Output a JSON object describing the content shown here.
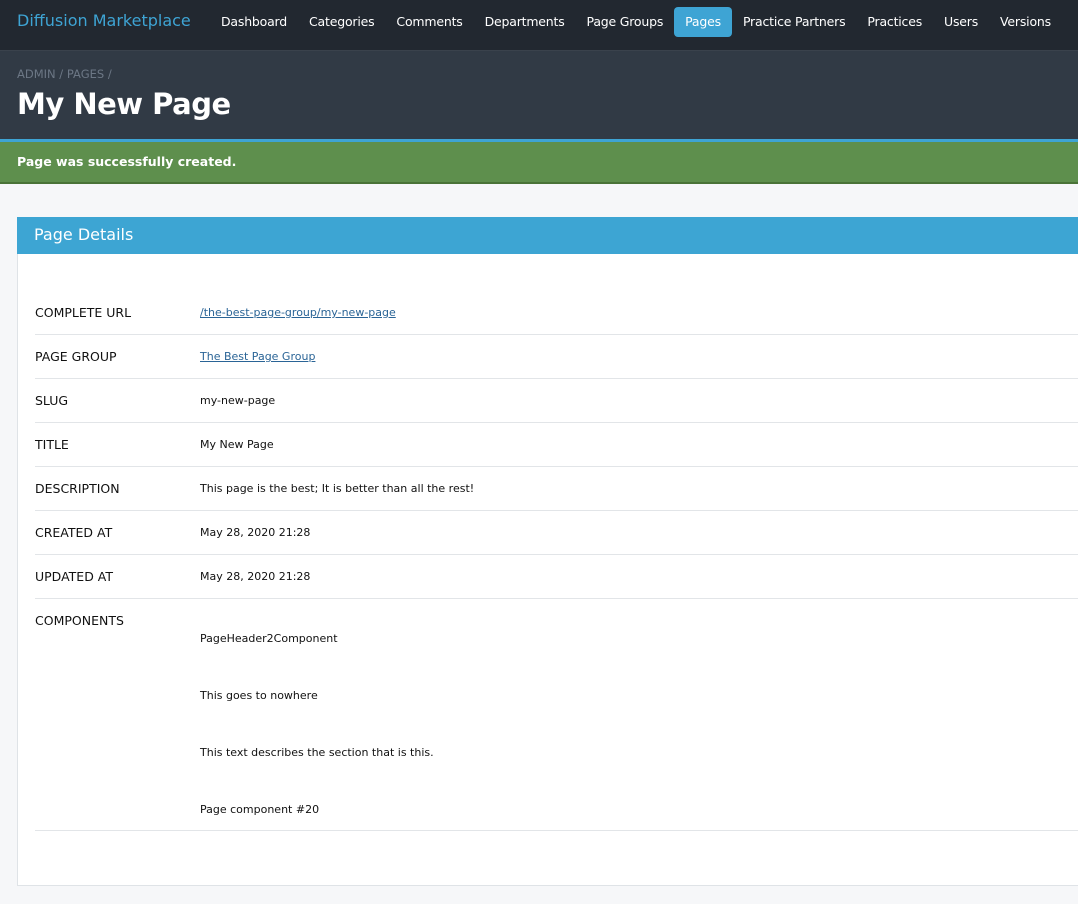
{
  "nav": {
    "brand": "Diffusion Marketplace",
    "items": [
      "Dashboard",
      "Categories",
      "Comments",
      "Departments",
      "Page Groups",
      "Pages",
      "Practice Partners",
      "Practices",
      "Users",
      "Versions"
    ],
    "active": "Pages"
  },
  "header": {
    "breadcrumb": [
      "ADMIN",
      "PAGES"
    ],
    "title": "My New Page"
  },
  "alert": {
    "message": "Page was successfully created."
  },
  "card": {
    "title": "Page Details",
    "rows": [
      {
        "label": "COMPLETE URL",
        "value": "/the-best-page-group/my-new-page"
      },
      {
        "label": "PAGE GROUP",
        "value": "The Best Page Group"
      },
      {
        "label": "SLUG",
        "value": "my-new-page"
      },
      {
        "label": "TITLE",
        "value": "My New Page"
      },
      {
        "label": "DESCRIPTION",
        "value": "This page is the best; It is better than all the rest!"
      },
      {
        "label": "CREATED AT",
        "value": "May 28, 2020 21:28"
      },
      {
        "label": "UPDATED AT",
        "value": "May 28, 2020 21:28"
      }
    ],
    "components": {
      "label": "COMPONENTS",
      "items": [
        "PageHeader2Component",
        "This goes to nowhere",
        "This text describes the section that is this.",
        "Page component #20"
      ]
    }
  },
  "colors": {
    "accent": "#3ea4d4",
    "success": "#5e8f4d",
    "nav_bg": "#222830",
    "header_bg": "#313a45"
  }
}
